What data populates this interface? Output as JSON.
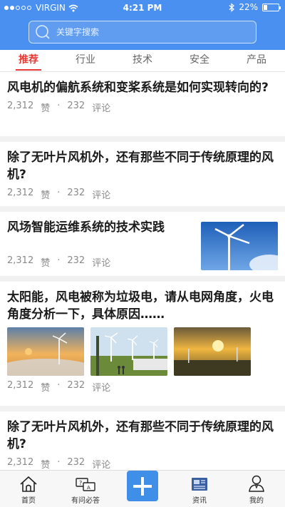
{
  "status_bar": {
    "carrier": "VIRGIN",
    "time": "4:21 PM",
    "battery": "22%",
    "battery_level": 0.22
  },
  "search": {
    "placeholder": "关键字搜索",
    "icon": "search-icon"
  },
  "tabs": [
    {
      "label": "推荐",
      "active": true
    },
    {
      "label": "行业",
      "active": false
    },
    {
      "label": "技术",
      "active": false
    },
    {
      "label": "安全",
      "active": false
    },
    {
      "label": "产品",
      "active": false
    }
  ],
  "articles": [
    {
      "title": "风电机的偏航系统和变桨系统是如何实现转向的?",
      "likes": "2,312",
      "like_label": "赞",
      "comments": "232",
      "comment_label": "评论"
    },
    {
      "title": "除了无叶片风机外，还有那些不同于传统原理的风机?",
      "likes": "2,312",
      "like_label": "赞",
      "comments": "232",
      "comment_label": "评论"
    },
    {
      "title": "风场智能运维系统的技术实践",
      "likes": "2,312",
      "like_label": "赞",
      "comments": "232",
      "comment_label": "评论"
    },
    {
      "title": "太阳能，风电被称为垃圾电，请从电网角度，火电角度分析一下，具体原因……",
      "likes": "2,312",
      "like_label": "赞",
      "comments": "232",
      "comment_label": "评论"
    },
    {
      "title": "除了无叶片风机外，还有那些不同于传统原理的风机?",
      "likes": "2,312",
      "like_label": "赞",
      "comments": "232",
      "comment_label": "评论"
    }
  ],
  "bottom_nav": [
    {
      "label": "首页",
      "icon": "home-icon"
    },
    {
      "label": "有问必答",
      "icon": "qa-icon"
    },
    {
      "label": "",
      "icon": "plus-icon"
    },
    {
      "label": "资讯",
      "icon": "news-icon"
    },
    {
      "label": "我的",
      "icon": "profile-icon"
    }
  ],
  "colors": {
    "header": "#4a90f0",
    "active_tab": "#e53935",
    "plus_button": "#3f8ee8"
  },
  "separator": "·"
}
